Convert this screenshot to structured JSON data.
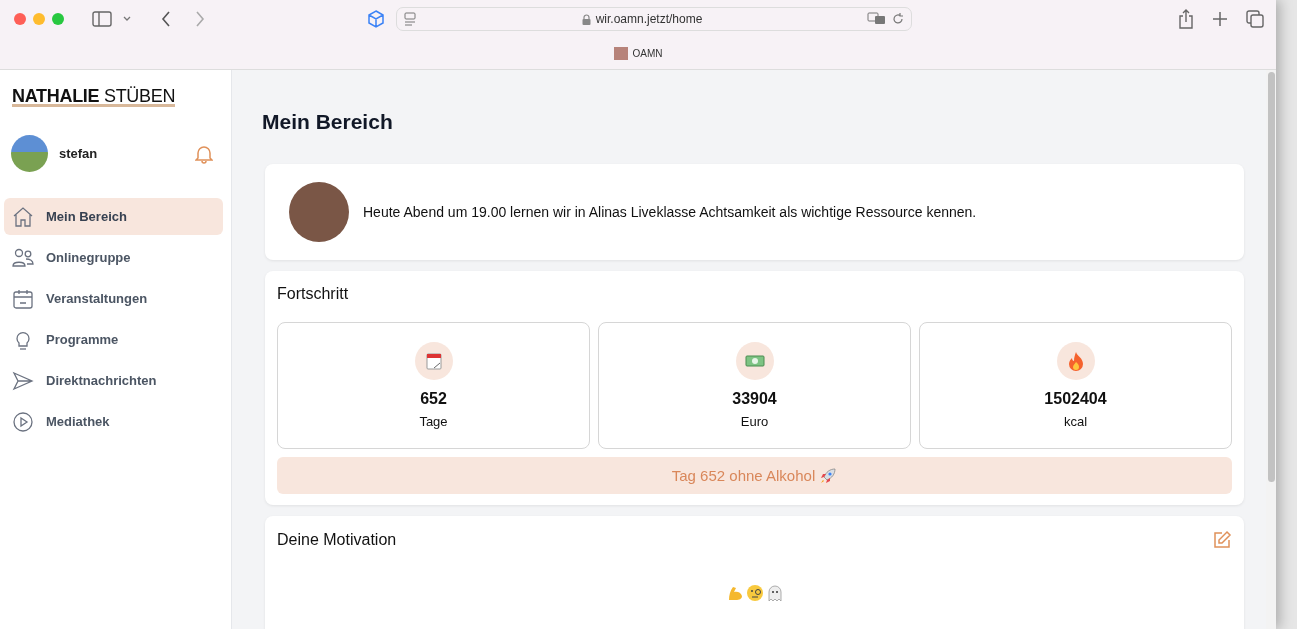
{
  "browser": {
    "url": "wir.oamn.jetzt/home",
    "tab": {
      "title": "OAMN"
    }
  },
  "sidebar": {
    "logo": {
      "bold": "NATHALIE",
      "light": "STÜBEN"
    },
    "user": {
      "name": "stefan"
    },
    "items": [
      {
        "label": "Mein Bereich",
        "selected": true
      },
      {
        "label": "Onlinegruppe",
        "selected": false
      },
      {
        "label": "Veranstaltungen",
        "selected": false
      },
      {
        "label": "Programme",
        "selected": false
      },
      {
        "label": "Direktnachrichten",
        "selected": false
      },
      {
        "label": "Mediathek",
        "selected": false
      }
    ]
  },
  "page": {
    "title": "Mein Bereich",
    "announcement": "Heute Abend um 19.00 lernen wir in Alinas Liveklasse Achtsamkeit als wichtige Ressource kennen.",
    "progress": {
      "title": "Fortschritt",
      "stats": [
        {
          "value": "652",
          "unit": "Tage"
        },
        {
          "value": "33904",
          "unit": "Euro"
        },
        {
          "value": "1502404",
          "unit": "kcal"
        }
      ],
      "banner": "Tag 652 ohne Alkohol"
    },
    "motivation": {
      "title": "Deine Motivation"
    }
  }
}
